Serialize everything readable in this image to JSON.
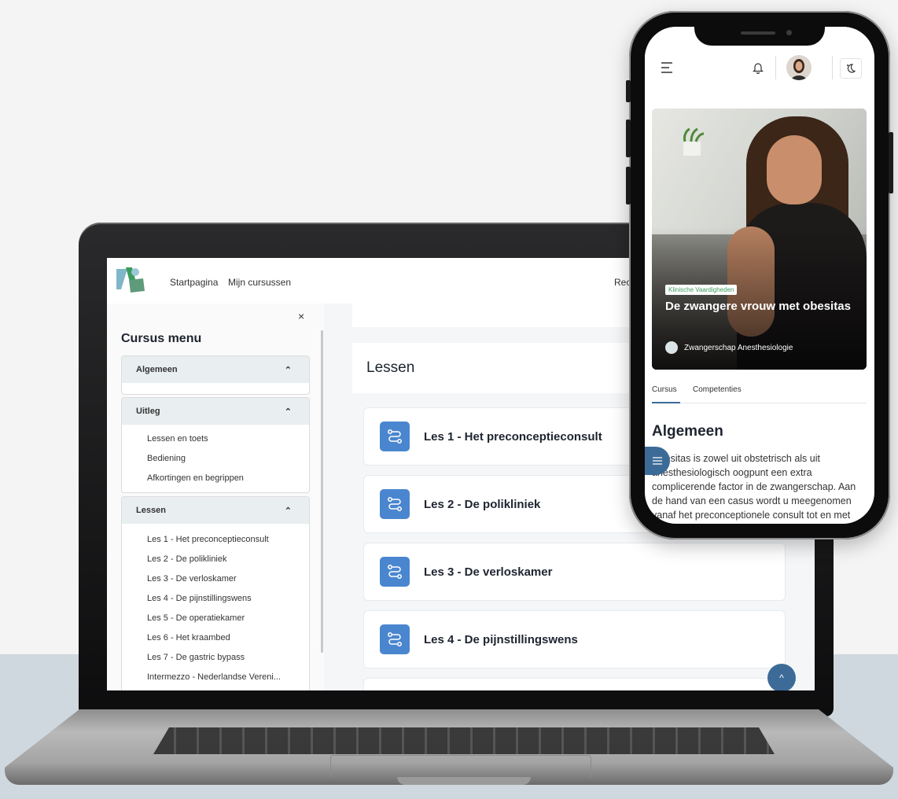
{
  "laptop": {
    "nav": {
      "logo_text": "ZA",
      "links": [
        "Startpagina",
        "Mijn cursussen"
      ],
      "right_partial": "Rec"
    },
    "sidebar": {
      "close": "×",
      "title": "Cursus menu",
      "sections": [
        {
          "title": "Algemeen",
          "items": []
        },
        {
          "title": "Uitleg",
          "items": [
            "Lessen en toets",
            "Bediening",
            "Afkortingen en begrippen"
          ]
        },
        {
          "title": "Lessen",
          "items": [
            "Les 1 - Het preconceptieconsult",
            "Les 2 - De polikliniek",
            "Les 3 - De verloskamer",
            "Les 4 - De pijnstillingswens",
            "Les 5 - De operatiekamer",
            "Les 6 - Het kraambed",
            "Les 7 - De gastric bypass",
            "Intermezzo - Nederlandse Vereni..."
          ]
        }
      ]
    },
    "main": {
      "heading": "Lessen",
      "lessons": [
        "Les 1 - Het preconceptieconsult",
        "Les 2 - De polikliniek",
        "Les 3 - De verloskamer",
        "Les 4 - De pijnstillingswens"
      ],
      "back_to_top": "^"
    }
  },
  "phone": {
    "header": {
      "menu_icon": "hamburger-icon",
      "bell_icon": "bell-icon",
      "theme_icon": "moon-icon"
    },
    "hero": {
      "tag": "Klinische Vaardigheden",
      "title": "De zwangere vrouw met obesitas",
      "author": "Zwangerschap Anesthesiologie"
    },
    "tabs": [
      "Cursus",
      "Competenties"
    ],
    "section_title": "Algemeen",
    "body_text": "Obesitas is zowel uit obstetrisch als uit anesthesiologisch oogpunt een extra complicerende factor in de zwangerschap. Aan de hand van een casus wordt u meegenomen vanaf het preconceptionele consult tot en met"
  },
  "colors": {
    "accent": "#4a86cf",
    "dark_accent": "#3d6b98",
    "tag_green": "#3c9b5c"
  }
}
